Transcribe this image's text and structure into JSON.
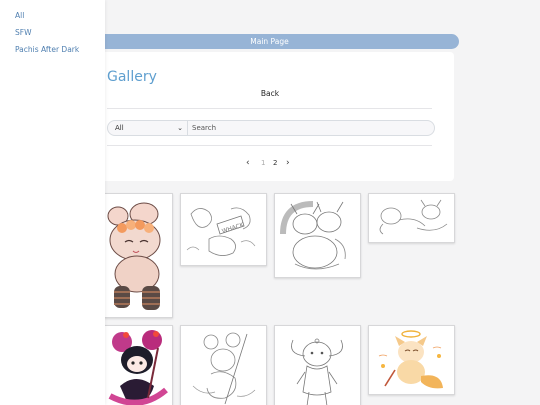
{
  "sidebar": {
    "links": [
      {
        "label": "All"
      },
      {
        "label": "SFW"
      },
      {
        "label": "Pachis After Dark"
      }
    ]
  },
  "banner": {
    "label": "Main Page"
  },
  "gallery": {
    "title": "Gallery",
    "back_label": "Back",
    "filter": {
      "selected": "All"
    },
    "search": {
      "placeholder": "Search"
    },
    "pagination": {
      "pages": [
        "1",
        "2"
      ],
      "current": "1"
    }
  },
  "thumbnails": [
    {
      "subject": "cream bunny chibi with orange flower crown and striped stockings, colored"
    },
    {
      "subject": "sketch of characters with WHACK text, line art"
    },
    {
      "subject": "chibi characters with horns sketch, line art"
    },
    {
      "subject": "sketch of lying characters, line art"
    },
    {
      "subject": "pink and black mouse character with staff, colored"
    },
    {
      "subject": "mouse character with staff sketch, line art"
    },
    {
      "subject": "standing chibi figure, line art"
    },
    {
      "subject": "golden fox chibi with halo, colored"
    }
  ],
  "colors": {
    "banner": "#97b4d6",
    "title": "#5f9fcf",
    "sidebar_link": "#4f7fb0",
    "background": "#f4f4f5"
  }
}
